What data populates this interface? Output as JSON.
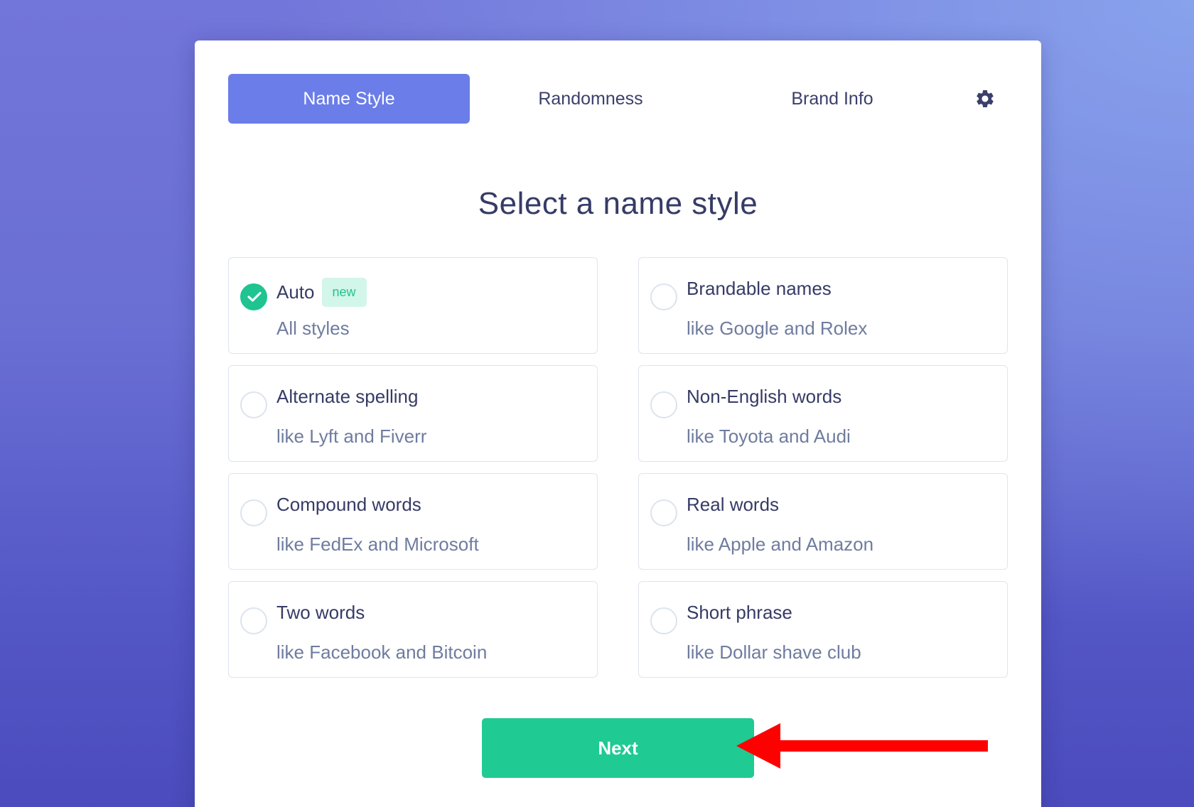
{
  "tabs": [
    {
      "label": "Name Style",
      "active": true
    },
    {
      "label": "Randomness",
      "active": false
    },
    {
      "label": "Brand Info",
      "active": false
    }
  ],
  "settings_icon": "gear-icon",
  "heading": "Select a name style",
  "options": [
    {
      "title": "Auto",
      "badge": "new",
      "subtitle": "All styles",
      "selected": true
    },
    {
      "title": "Brandable names",
      "subtitle": "like Google and Rolex",
      "selected": false
    },
    {
      "title": "Alternate spelling",
      "subtitle": "like Lyft and Fiverr",
      "selected": false
    },
    {
      "title": "Non-English words",
      "subtitle": "like Toyota and Audi",
      "selected": false
    },
    {
      "title": "Compound words",
      "subtitle": "like FedEx and Microsoft",
      "selected": false
    },
    {
      "title": "Real words",
      "subtitle": "like Apple and Amazon",
      "selected": false
    },
    {
      "title": "Two words",
      "subtitle": "like Facebook and Bitcoin",
      "selected": false
    },
    {
      "title": "Short phrase",
      "subtitle": "like Dollar shave club",
      "selected": false
    }
  ],
  "next_label": "Next",
  "colors": {
    "accent": "#6b7de8",
    "success": "#1fca93",
    "annotation_arrow": "#ff0000"
  }
}
